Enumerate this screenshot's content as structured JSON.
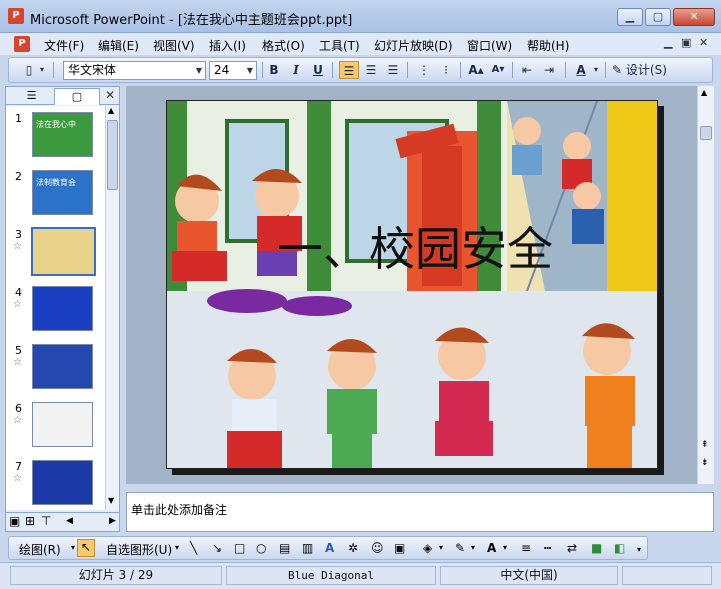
{
  "window": {
    "title": "Microsoft PowerPoint - [法在我心中主题班会ppt.ppt]",
    "app_icon": "P"
  },
  "menu": {
    "items": [
      "文件(F)",
      "编辑(E)",
      "视图(V)",
      "插入(I)",
      "格式(O)",
      "工具(T)",
      "幻灯片放映(D)",
      "窗口(W)",
      "帮助(H)"
    ]
  },
  "toolbar": {
    "font_name": "华文宋体",
    "font_size": "24",
    "bold": "B",
    "italic": "I",
    "underline": "U",
    "font_color_label": "A",
    "design_label": "设计(S)"
  },
  "slides_panel": {
    "thumbnails": [
      {
        "num": "1",
        "text": "法在我心中",
        "bg": "#3c9a3c",
        "star": false
      },
      {
        "num": "2",
        "text": "法制教育会",
        "bg": "#2a73c9",
        "star": false
      },
      {
        "num": "3",
        "text": "",
        "bg": "#e8d28a",
        "star": true
      },
      {
        "num": "4",
        "text": "",
        "bg": "#1a3fc2",
        "star": true
      },
      {
        "num": "5",
        "text": "",
        "bg": "#2447b0",
        "star": true
      },
      {
        "num": "6",
        "text": "",
        "bg": "#f2f2f2",
        "star": true
      },
      {
        "num": "7",
        "text": "",
        "bg": "#1b3aa8",
        "star": true
      }
    ],
    "selected_index": 2
  },
  "slide": {
    "title": "一、校园安全"
  },
  "notes": {
    "placeholder": "单击此处添加备注"
  },
  "drawing": {
    "draw_label": "绘图(R)",
    "autoshape_label": "自选图形(U)"
  },
  "status": {
    "slide_pos": "幻灯片 3 / 29",
    "theme": "Blue Diagonal",
    "language": "中文(中国)"
  },
  "colors": {
    "accent": "#3a6ec6",
    "close": "#c7452f"
  }
}
